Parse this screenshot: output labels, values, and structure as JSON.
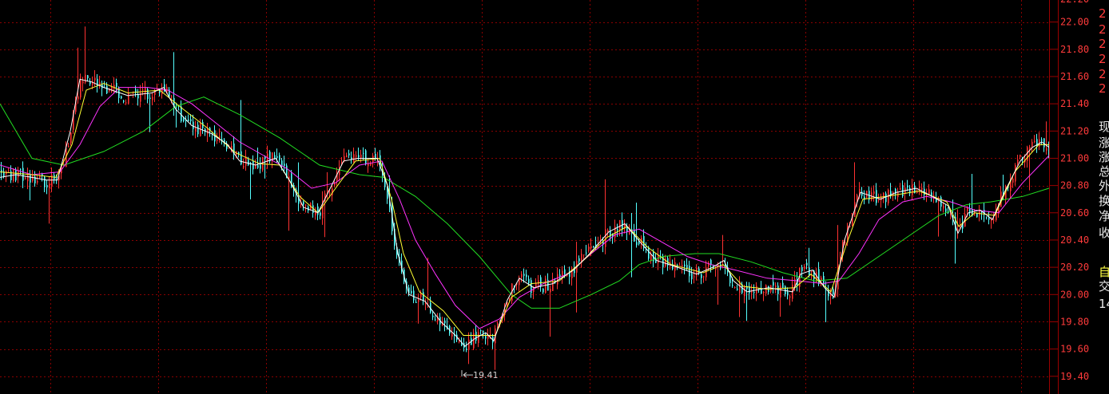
{
  "colors": {
    "background": "#000000",
    "grid": "#8a0000",
    "axis_line": "#9a0000",
    "axis_text": "#ff3b3b",
    "candle_up": "#ff3232",
    "candle_down": "#54ffff",
    "ma_short": "#ffffff",
    "ma_medium": "#ffff33",
    "ma_long": "#ff33ff",
    "ma_xlong": "#22dd22",
    "min_label": "#d0d0d0"
  },
  "chart_data": {
    "type": "candlestick",
    "title": "",
    "ylabel": "",
    "ylim": [
      19.35,
      22.15
    ],
    "yticks": [
      19.4,
      19.6,
      19.8,
      20.0,
      20.2,
      20.4,
      20.6,
      20.8,
      21.0,
      21.2,
      21.4,
      21.6,
      21.8,
      22.0
    ],
    "ytick_labels": [
      "19.40",
      "19.60",
      "19.80",
      "20.00",
      "20.20",
      "20.40",
      "20.60",
      "20.80",
      "21.00",
      "21.20",
      "21.40",
      "21.60",
      "21.80",
      "22.00"
    ],
    "grid": true,
    "min_annotation": {
      "label": "19.41",
      "value": 19.41
    },
    "price_path": [
      [
        0,
        20.9
      ],
      [
        18,
        20.88
      ],
      [
        40,
        20.86
      ],
      [
        58,
        20.83
      ],
      [
        72,
        20.85
      ],
      [
        88,
        21.2
      ],
      [
        100,
        21.6
      ],
      [
        112,
        21.56
      ],
      [
        130,
        21.52
      ],
      [
        160,
        21.45
      ],
      [
        185,
        21.48
      ],
      [
        205,
        21.52
      ],
      [
        220,
        21.35
      ],
      [
        235,
        21.24
      ],
      [
        260,
        21.2
      ],
      [
        280,
        21.12
      ],
      [
        300,
        20.98
      ],
      [
        320,
        20.95
      ],
      [
        345,
        21.02
      ],
      [
        360,
        20.85
      ],
      [
        378,
        20.65
      ],
      [
        398,
        20.6
      ],
      [
        412,
        20.78
      ],
      [
        428,
        20.98
      ],
      [
        445,
        21.0
      ],
      [
        470,
        21.0
      ],
      [
        482,
        20.8
      ],
      [
        495,
        20.3
      ],
      [
        510,
        20.0
      ],
      [
        530,
        19.95
      ],
      [
        550,
        19.8
      ],
      [
        568,
        19.7
      ],
      [
        580,
        19.62
      ],
      [
        592,
        19.68
      ],
      [
        605,
        19.72
      ],
      [
        615,
        19.66
      ],
      [
        632,
        19.95
      ],
      [
        648,
        20.12
      ],
      [
        665,
        20.05
      ],
      [
        690,
        20.08
      ],
      [
        715,
        20.18
      ],
      [
        735,
        20.3
      ],
      [
        760,
        20.45
      ],
      [
        780,
        20.52
      ],
      [
        800,
        20.38
      ],
      [
        820,
        20.25
      ],
      [
        845,
        20.2
      ],
      [
        870,
        20.15
      ],
      [
        890,
        20.2
      ],
      [
        905,
        20.25
      ],
      [
        915,
        20.1
      ],
      [
        932,
        20.02
      ],
      [
        960,
        20.05
      ],
      [
        990,
        20.02
      ],
      [
        1000,
        20.15
      ],
      [
        1015,
        20.18
      ],
      [
        1030,
        20.05
      ],
      [
        1042,
        19.98
      ],
      [
        1055,
        20.4
      ],
      [
        1075,
        20.75
      ],
      [
        1100,
        20.7
      ],
      [
        1120,
        20.75
      ],
      [
        1145,
        20.78
      ],
      [
        1165,
        20.72
      ],
      [
        1185,
        20.65
      ],
      [
        1197,
        20.45
      ],
      [
        1210,
        20.6
      ],
      [
        1225,
        20.62
      ],
      [
        1240,
        20.55
      ],
      [
        1255,
        20.75
      ],
      [
        1275,
        20.98
      ],
      [
        1290,
        21.08
      ],
      [
        1302,
        21.12
      ],
      [
        1313,
        21.08
      ]
    ],
    "series": [
      {
        "key": "ma_xlong",
        "points": [
          [
            0,
            21.4
          ],
          [
            40,
            21.0
          ],
          [
            80,
            20.95
          ],
          [
            130,
            21.05
          ],
          [
            180,
            21.2
          ],
          [
            220,
            21.38
          ],
          [
            255,
            21.45
          ],
          [
            300,
            21.32
          ],
          [
            350,
            21.15
          ],
          [
            400,
            20.95
          ],
          [
            450,
            20.88
          ],
          [
            480,
            20.86
          ],
          [
            520,
            20.72
          ],
          [
            560,
            20.52
          ],
          [
            600,
            20.28
          ],
          [
            640,
            20.0
          ],
          [
            665,
            19.9
          ],
          [
            700,
            19.9
          ],
          [
            740,
            20.0
          ],
          [
            775,
            20.1
          ],
          [
            800,
            20.22
          ],
          [
            830,
            20.28
          ],
          [
            870,
            20.3
          ],
          [
            900,
            20.3
          ],
          [
            940,
            20.24
          ],
          [
            980,
            20.16
          ],
          [
            1020,
            20.1
          ],
          [
            1060,
            20.12
          ],
          [
            1100,
            20.28
          ],
          [
            1140,
            20.44
          ],
          [
            1175,
            20.58
          ],
          [
            1210,
            20.66
          ],
          [
            1240,
            20.68
          ],
          [
            1280,
            20.72
          ],
          [
            1313,
            20.78
          ]
        ]
      },
      {
        "key": "ma_long",
        "points": [
          [
            0,
            20.95
          ],
          [
            40,
            20.88
          ],
          [
            75,
            20.9
          ],
          [
            100,
            21.1
          ],
          [
            125,
            21.38
          ],
          [
            150,
            21.52
          ],
          [
            185,
            21.52
          ],
          [
            210,
            21.5
          ],
          [
            240,
            21.4
          ],
          [
            270,
            21.26
          ],
          [
            300,
            21.12
          ],
          [
            330,
            21.02
          ],
          [
            360,
            20.92
          ],
          [
            390,
            20.78
          ],
          [
            420,
            20.82
          ],
          [
            450,
            20.95
          ],
          [
            478,
            20.98
          ],
          [
            500,
            20.7
          ],
          [
            520,
            20.4
          ],
          [
            545,
            20.15
          ],
          [
            570,
            19.92
          ],
          [
            600,
            19.75
          ],
          [
            625,
            19.82
          ],
          [
            650,
            19.98
          ],
          [
            680,
            20.08
          ],
          [
            710,
            20.15
          ],
          [
            740,
            20.3
          ],
          [
            770,
            20.44
          ],
          [
            800,
            20.48
          ],
          [
            830,
            20.38
          ],
          [
            860,
            20.28
          ],
          [
            890,
            20.22
          ],
          [
            920,
            20.18
          ],
          [
            960,
            20.12
          ],
          [
            1000,
            20.1
          ],
          [
            1030,
            20.08
          ],
          [
            1050,
            20.1
          ],
          [
            1075,
            20.3
          ],
          [
            1100,
            20.55
          ],
          [
            1130,
            20.68
          ],
          [
            1160,
            20.72
          ],
          [
            1190,
            20.68
          ],
          [
            1220,
            20.62
          ],
          [
            1250,
            20.6
          ],
          [
            1280,
            20.82
          ],
          [
            1313,
            21.02
          ]
        ]
      },
      {
        "key": "ma_medium",
        "points": [
          [
            0,
            20.9
          ],
          [
            40,
            20.88
          ],
          [
            70,
            20.86
          ],
          [
            90,
            21.1
          ],
          [
            108,
            21.5
          ],
          [
            130,
            21.55
          ],
          [
            160,
            21.48
          ],
          [
            200,
            21.5
          ],
          [
            225,
            21.38
          ],
          [
            260,
            21.22
          ],
          [
            295,
            21.04
          ],
          [
            325,
            20.96
          ],
          [
            350,
            20.95
          ],
          [
            375,
            20.72
          ],
          [
            398,
            20.6
          ],
          [
            420,
            20.78
          ],
          [
            445,
            20.98
          ],
          [
            475,
            21.0
          ],
          [
            490,
            20.7
          ],
          [
            505,
            20.3
          ],
          [
            525,
            20.02
          ],
          [
            555,
            19.88
          ],
          [
            580,
            19.7
          ],
          [
            605,
            19.7
          ],
          [
            620,
            19.7
          ],
          [
            640,
            19.98
          ],
          [
            665,
            20.08
          ],
          [
            700,
            20.1
          ],
          [
            730,
            20.25
          ],
          [
            760,
            20.42
          ],
          [
            785,
            20.5
          ],
          [
            810,
            20.35
          ],
          [
            840,
            20.22
          ],
          [
            880,
            20.16
          ],
          [
            905,
            20.22
          ],
          [
            930,
            20.06
          ],
          [
            960,
            20.04
          ],
          [
            995,
            20.05
          ],
          [
            1015,
            20.15
          ],
          [
            1040,
            20.02
          ],
          [
            1060,
            20.38
          ],
          [
            1080,
            20.7
          ],
          [
            1110,
            20.72
          ],
          [
            1150,
            20.76
          ],
          [
            1185,
            20.68
          ],
          [
            1200,
            20.5
          ],
          [
            1220,
            20.6
          ],
          [
            1245,
            20.58
          ],
          [
            1270,
            20.9
          ],
          [
            1300,
            21.1
          ],
          [
            1313,
            21.1
          ]
        ]
      },
      {
        "key": "ma_short",
        "points": [
          [
            0,
            20.86
          ],
          [
            20,
            20.88
          ],
          [
            40,
            20.86
          ],
          [
            58,
            20.84
          ],
          [
            72,
            20.84
          ],
          [
            88,
            21.2
          ],
          [
            100,
            21.58
          ],
          [
            115,
            21.56
          ],
          [
            130,
            21.52
          ],
          [
            160,
            21.46
          ],
          [
            190,
            21.48
          ],
          [
            205,
            21.52
          ],
          [
            220,
            21.36
          ],
          [
            240,
            21.24
          ],
          [
            265,
            21.18
          ],
          [
            285,
            21.1
          ],
          [
            300,
            20.98
          ],
          [
            320,
            20.95
          ],
          [
            345,
            21.0
          ],
          [
            362,
            20.84
          ],
          [
            380,
            20.64
          ],
          [
            398,
            20.6
          ],
          [
            415,
            20.8
          ],
          [
            430,
            20.98
          ],
          [
            448,
            21.0
          ],
          [
            472,
            21.0
          ],
          [
            485,
            20.8
          ],
          [
            498,
            20.3
          ],
          [
            512,
            20.0
          ],
          [
            532,
            19.95
          ],
          [
            552,
            19.8
          ],
          [
            570,
            19.7
          ],
          [
            582,
            19.62
          ],
          [
            595,
            19.68
          ],
          [
            608,
            19.72
          ],
          [
            618,
            19.66
          ],
          [
            635,
            19.96
          ],
          [
            650,
            20.12
          ],
          [
            668,
            20.05
          ],
          [
            692,
            20.08
          ],
          [
            718,
            20.18
          ],
          [
            738,
            20.3
          ],
          [
            762,
            20.46
          ],
          [
            782,
            20.52
          ],
          [
            802,
            20.38
          ],
          [
            822,
            20.25
          ],
          [
            848,
            20.2
          ],
          [
            872,
            20.15
          ],
          [
            892,
            20.2
          ],
          [
            906,
            20.25
          ],
          [
            918,
            20.1
          ],
          [
            935,
            20.02
          ],
          [
            962,
            20.05
          ],
          [
            992,
            20.02
          ],
          [
            1002,
            20.15
          ],
          [
            1017,
            20.18
          ],
          [
            1032,
            20.05
          ],
          [
            1044,
            19.98
          ],
          [
            1057,
            20.4
          ],
          [
            1077,
            20.75
          ],
          [
            1102,
            20.7
          ],
          [
            1122,
            20.75
          ],
          [
            1147,
            20.78
          ],
          [
            1167,
            20.72
          ],
          [
            1187,
            20.65
          ],
          [
            1199,
            20.45
          ],
          [
            1212,
            20.6
          ],
          [
            1227,
            20.62
          ],
          [
            1242,
            20.55
          ],
          [
            1257,
            20.75
          ],
          [
            1277,
            20.98
          ],
          [
            1292,
            21.08
          ],
          [
            1304,
            21.12
          ],
          [
            1313,
            21.08
          ]
        ]
      }
    ]
  },
  "side_panel": {
    "glyphs": [
      "现",
      "涨",
      "涨",
      "总",
      "外",
      "换",
      "净",
      "收",
      "自",
      "交",
      "14"
    ],
    "glyph_colors": [
      "#e8e8e8",
      "#e8e8e8",
      "#e8e8e8",
      "#e8e8e8",
      "#e8e8e8",
      "#e8e8e8",
      "#e8e8e8",
      "#e8e8e8",
      "#ffff44",
      "#e8e8e8",
      "#e8e8e8"
    ],
    "top_digits": [
      "2",
      "2",
      "2",
      "2",
      "2",
      "2"
    ]
  }
}
